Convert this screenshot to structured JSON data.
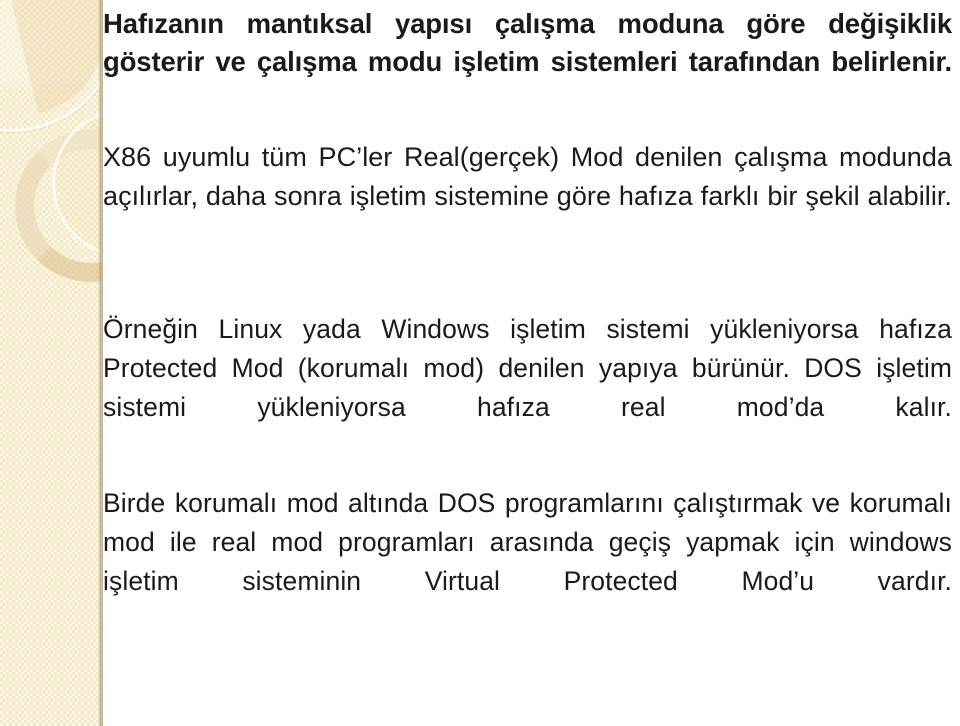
{
  "slide": {
    "background_color": "#ffffff",
    "sidebar": {
      "band_color": "#f3e7c6",
      "edge_color": "#b09c70",
      "ring_fill_color": "#dec898",
      "ring_outline_color": "#fffdf4"
    },
    "text_color": "#1a1a1a",
    "paragraphs": [
      {
        "id": "para-1",
        "text": "Hafızanın mantıksal yapısı çalışma moduna göre değişiklik gösterir ve çalışma modu işletim sistemleri tarafından belirlenir."
      },
      {
        "id": "para-2",
        "text": "X86 uyumlu tüm PC’ler Real(gerçek) Mod denilen çalışma modunda açılırlar, daha sonra işletim sistemine göre hafıza farklı bir şekil alabilir."
      },
      {
        "id": "para-3",
        "text": "Örneğin Linux yada Windows işletim sistemi yükleniyorsa hafıza Protected Mod (korumalı mod) denilen yapıya bürünür. DOS işletim sistemi yükleniyorsa hafıza real mod’da kalır."
      },
      {
        "id": "para-4",
        "text": "Birde korumalı mod altında DOS programlarını çalıştırmak ve korumalı mod ile real mod programları arasında geçiş yapmak için windows işletim sisteminin Virtual Protected Mod’u vardır."
      }
    ]
  }
}
